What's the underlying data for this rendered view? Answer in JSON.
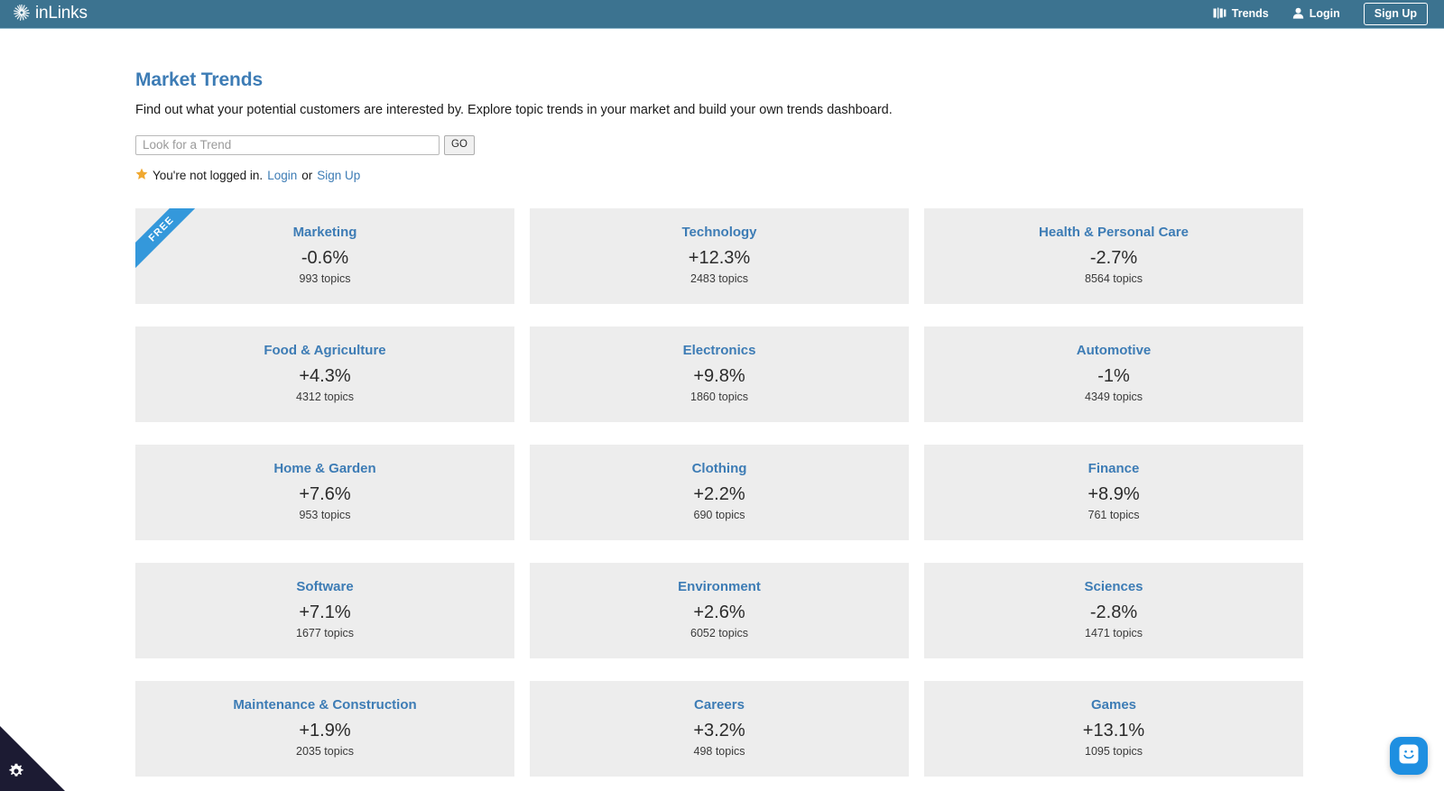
{
  "navbar": {
    "brand": "inLinks",
    "brand_icon": "sunburst-logo-icon",
    "links": [
      {
        "label": "Trends",
        "icon": "bar-chart-icon"
      },
      {
        "label": "Login",
        "icon": "user-icon"
      }
    ],
    "signup_label": "Sign Up"
  },
  "main": {
    "title": "Market Trends",
    "description": "Find out what your potential customers are interested by. Explore topic trends in your market and build your own trends dashboard.",
    "search": {
      "placeholder": "Look for a Trend",
      "value": "",
      "go_label": "GO"
    },
    "login_note": {
      "icon": "star-icon",
      "text": "You're not logged in.",
      "login_label": "Login",
      "separator": "or",
      "signup_label": "Sign Up"
    }
  },
  "cards": [
    {
      "title": "Marketing",
      "change": "-0.6%",
      "topics": "993 topics",
      "ribbon": "FREE"
    },
    {
      "title": "Technology",
      "change": "+12.3%",
      "topics": "2483 topics",
      "ribbon": null
    },
    {
      "title": "Health & Personal Care",
      "change": "-2.7%",
      "topics": "8564 topics",
      "ribbon": null
    },
    {
      "title": "Food & Agriculture",
      "change": "+4.3%",
      "topics": "4312 topics",
      "ribbon": null
    },
    {
      "title": "Electronics",
      "change": "+9.8%",
      "topics": "1860 topics",
      "ribbon": null
    },
    {
      "title": "Automotive",
      "change": "-1%",
      "topics": "4349 topics",
      "ribbon": null
    },
    {
      "title": "Home & Garden",
      "change": "+7.6%",
      "topics": "953 topics",
      "ribbon": null
    },
    {
      "title": "Clothing",
      "change": "+2.2%",
      "topics": "690 topics",
      "ribbon": null
    },
    {
      "title": "Finance",
      "change": "+8.9%",
      "topics": "761 topics",
      "ribbon": null
    },
    {
      "title": "Software",
      "change": "+7.1%",
      "topics": "1677 topics",
      "ribbon": null
    },
    {
      "title": "Environment",
      "change": "+2.6%",
      "topics": "6052 topics",
      "ribbon": null
    },
    {
      "title": "Sciences",
      "change": "-2.8%",
      "topics": "1471 topics",
      "ribbon": null
    },
    {
      "title": "Maintenance & Construction",
      "change": "+1.9%",
      "topics": "2035 topics",
      "ribbon": null
    },
    {
      "title": "Careers",
      "change": "+3.2%",
      "topics": "498 topics",
      "ribbon": null
    },
    {
      "title": "Games",
      "change": "+13.1%",
      "topics": "1095 topics",
      "ribbon": null
    }
  ],
  "widgets": {
    "cookie_settings_icon": "gear-icon",
    "chat_icon": "smiley-face-icon"
  },
  "colors": {
    "navbar_bg": "#3c7390",
    "accent_blue": "#3d7cb5",
    "card_bg": "#ededed",
    "ribbon_blue": "#3498db",
    "star_gold": "#f0a830",
    "chat_blue": "#1e8fe1",
    "cookie_dark": "#1c1b33"
  }
}
